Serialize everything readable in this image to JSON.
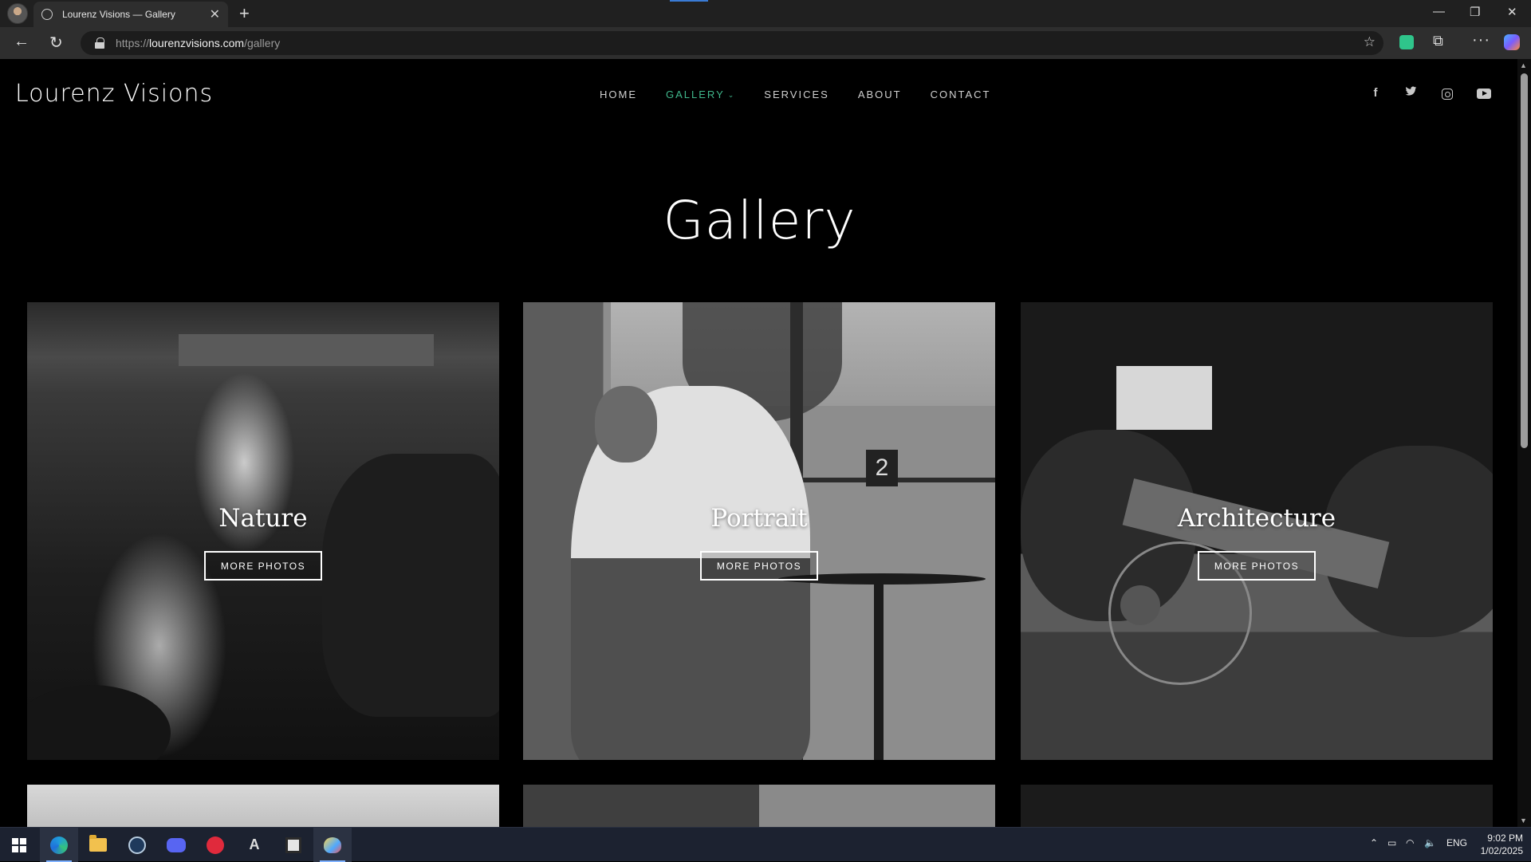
{
  "browser": {
    "tab_title": "Lourenz Visions — Gallery",
    "new_tab": "+",
    "tab_close": "✕",
    "url_prefix": "https://",
    "url_domain": "lourenzvisions.com",
    "url_path": "/gallery",
    "back": "←",
    "reload": "↻",
    "favorite": "☆",
    "extensions": "⧉",
    "more": "···",
    "minimize": "—",
    "restore": "❐",
    "close": "✕"
  },
  "site": {
    "logo": "Lourenz Visions",
    "nav": [
      {
        "label": "HOME",
        "active": false
      },
      {
        "label": "GALLERY",
        "active": true
      },
      {
        "label": "SERVICES",
        "active": false
      },
      {
        "label": "ABOUT",
        "active": false
      },
      {
        "label": "CONTACT",
        "active": false
      }
    ],
    "nav_chevron": "⌄",
    "social": {
      "facebook": "f",
      "twitter": "🐦",
      "instagram": "instagram",
      "youtube": "youtube"
    },
    "accent_color": "#3fb68b"
  },
  "gallery": {
    "title": "Gallery",
    "cards": [
      {
        "label": "Nature",
        "button": "MORE PHOTOS"
      },
      {
        "label": "Portrait",
        "button": "MORE PHOTOS"
      },
      {
        "label": "Architecture",
        "button": "MORE PHOTOS"
      }
    ],
    "portrait_table_number": "2"
  },
  "taskbar": {
    "apps": [
      "start",
      "edge",
      "file-explorer",
      "steam",
      "discord",
      "red-app",
      "a-app",
      "minecraft",
      "paint"
    ],
    "language": "ENG",
    "time": "9:02 PM",
    "date": "1/02/2025"
  }
}
